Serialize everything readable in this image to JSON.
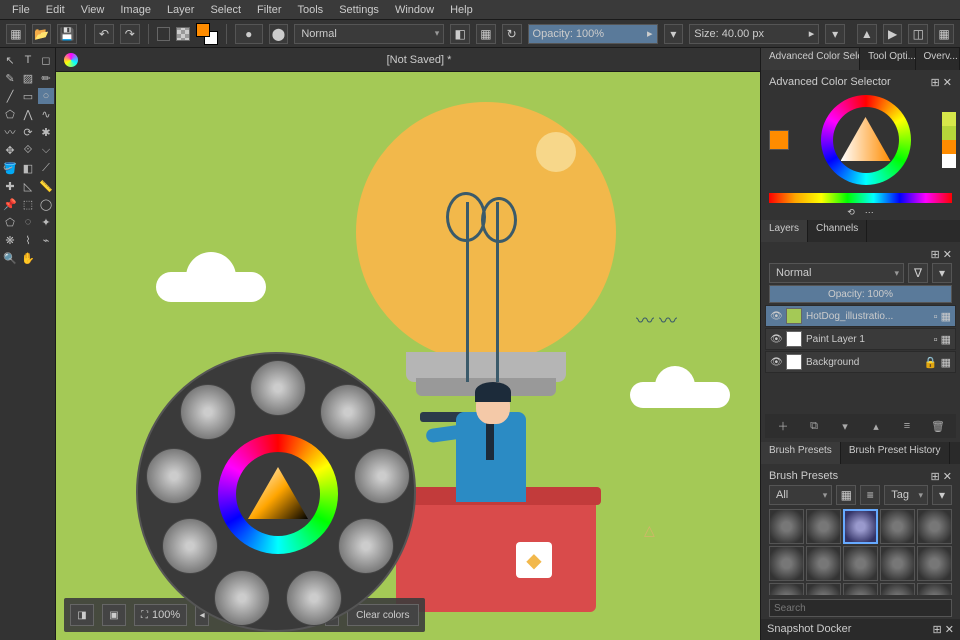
{
  "menu": {
    "file": "File",
    "edit": "Edit",
    "view": "View",
    "image": "Image",
    "layer": "Layer",
    "select": "Select",
    "filter": "Filter",
    "tools": "Tools",
    "settings": "Settings",
    "window": "Window",
    "help": "Help"
  },
  "toolbar": {
    "blend_mode": "Normal",
    "opacity_label": "Opacity: 100%",
    "size_label": "Size: 40.00 px"
  },
  "document": {
    "title": "[Not Saved]  *"
  },
  "zoom": "100%",
  "clear_colors": "Clear colors",
  "right_panels": {
    "tabs": {
      "adv": "Advanced Color Sele...",
      "tool": "Tool Opti...",
      "over": "Overv..."
    },
    "color_selector_title": "Advanced Color Selector",
    "layers_tab": "Layers",
    "channels_tab": "Channels",
    "blend": "Normal",
    "opacity": "Opacity:   100%",
    "layers": [
      {
        "name": "HotDog_illustratio...",
        "selected": true,
        "locked": false
      },
      {
        "name": "Paint Layer 1",
        "selected": false,
        "locked": false
      },
      {
        "name": "Background",
        "selected": false,
        "locked": true
      }
    ],
    "brush_presets_tab": "Brush Presets",
    "brush_history_tab": "Brush Preset History",
    "brush_presets_title": "Brush Presets",
    "brush_filter": "All",
    "brush_tag": "Tag",
    "search": "Search",
    "snapshot": "Snapshot Docker"
  },
  "palette_colors": [
    "#d6e84a",
    "#b5d63a",
    "#ff8c00",
    "#ffffff"
  ]
}
